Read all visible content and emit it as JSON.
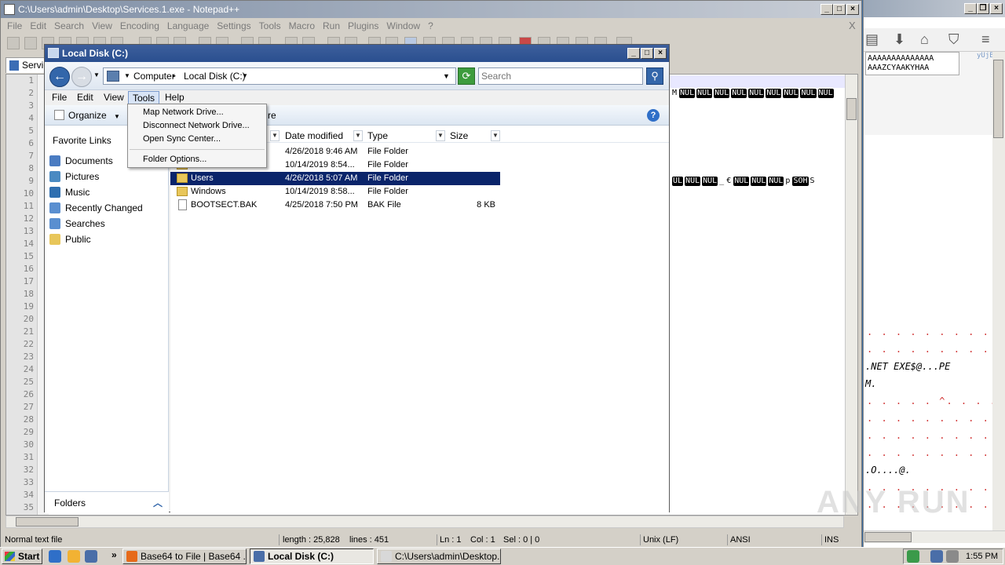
{
  "notepad": {
    "title": "C:\\Users\\admin\\Desktop\\Services.1.exe - Notepad++",
    "menu": [
      "File",
      "Edit",
      "Search",
      "View",
      "Encoding",
      "Language",
      "Settings",
      "Tools",
      "Macro",
      "Run",
      "Plugins",
      "Window",
      "?"
    ],
    "close_x": "X",
    "tab_label": "Servic",
    "line_numbers": [
      "1",
      "2",
      "3",
      "4",
      "5",
      "6",
      "7",
      "8",
      "9",
      "10",
      "11",
      "12",
      "13",
      "14",
      "15",
      "16",
      "17",
      "18",
      "19",
      "20",
      "21",
      "22",
      "23",
      "24",
      "25",
      "26",
      "27",
      "28",
      "29",
      "30",
      "31",
      "32",
      "33",
      "34",
      "35"
    ],
    "line2_tokens": [
      "M",
      "NUL",
      "NUL",
      "NUL",
      "NUL",
      "NUL",
      "NUL",
      "NUL",
      "NUL",
      "NUL"
    ],
    "line9_tokens": [
      "UL",
      "NUL",
      "NUL",
      "_",
      "€",
      "NUL",
      "NUL",
      "NUL",
      "p",
      "SOH",
      "S"
    ],
    "status": {
      "file_type": "Normal text file",
      "length": "length : 25,828",
      "lines": "lines : 451",
      "ln": "Ln : 1",
      "col": "Col : 1",
      "sel": "Sel : 0 | 0",
      "eol": "Unix (LF)",
      "encoding": "ANSI",
      "mode": "INS"
    }
  },
  "browser_strip": {
    "textbox_line1": "AAAAAAAAAAAAAA",
    "textbox_line2": "AAAZCYAAKYHAA",
    "hex_rows": [
      {
        "kind": "dots",
        "text": ". . . . . . . . . . . . . . ."
      },
      {
        "kind": "dots",
        "text": ". . . . . . . . . . . . . ! . ."
      },
      {
        "kind": "hex",
        "text": ".NET EXE$@...PE"
      },
      {
        "kind": "hex",
        "text": "M."
      },
      {
        "kind": "dots",
        "text": ". . . . . ^. . . . . . . . @"
      },
      {
        "kind": "dots",
        "text": ". . . . . . . . . . . . . . . ."
      },
      {
        "kind": "dots",
        "text": ". . . . . . . . . . . . . @."
      },
      {
        "kind": "dots",
        "text": ". . . . . . . . . . . . . . . ."
      },
      {
        "kind": "hex",
        "text": ".O....@."
      },
      {
        "kind": "dots",
        "text": ". . . . . . . . . . . . . . . ."
      },
      {
        "kind": "dots",
        "text": ". . . . . . . . . . . . . . . ."
      }
    ],
    "watermark": "ANY RUN"
  },
  "explorer": {
    "title": "Local Disk (C:)",
    "breadcrumb": [
      "Computer",
      "Local Disk (C:)"
    ],
    "search_placeholder": "Search",
    "menu": [
      "File",
      "Edit",
      "View",
      "Tools",
      "Help"
    ],
    "organize_label": "Organize",
    "partial_cmd_label": "re",
    "favorites_header": "Favorite Links",
    "favorites": [
      {
        "label": "Documents",
        "icon": "documents-icon",
        "color": "#4a7cc2"
      },
      {
        "label": "Pictures",
        "icon": "pictures-icon",
        "color": "#4a8ac2"
      },
      {
        "label": "Music",
        "icon": "music-icon",
        "color": "#2f6fb0"
      },
      {
        "label": "Recently Changed",
        "icon": "recent-icon",
        "color": "#5a8fd0"
      },
      {
        "label": "Searches",
        "icon": "searches-icon",
        "color": "#5a8fd0"
      },
      {
        "label": "Public",
        "icon": "public-folder-icon",
        "color": "#e8c65a"
      }
    ],
    "folders_label": "Folders",
    "columns": {
      "date": "Date modified",
      "type": "Type",
      "size": "Size"
    },
    "rows": [
      {
        "name": "",
        "date": "4/26/2018 9:46 AM",
        "type": "File Folder",
        "size": "",
        "selected": false,
        "file": false
      },
      {
        "name": "",
        "date": "10/14/2019 8:54...",
        "type": "File Folder",
        "size": "",
        "selected": false,
        "file": false
      },
      {
        "name": "Users",
        "date": "4/26/2018 5:07 AM",
        "type": "File Folder",
        "size": "",
        "selected": true,
        "file": false
      },
      {
        "name": "Windows",
        "date": "10/14/2019 8:58...",
        "type": "File Folder",
        "size": "",
        "selected": false,
        "file": false
      },
      {
        "name": "BOOTSECT.BAK",
        "date": "4/25/2018 7:50 PM",
        "type": "BAK File",
        "size": "8 KB",
        "selected": false,
        "file": true
      }
    ],
    "tools_menu": [
      "Map Network Drive...",
      "Disconnect Network Drive...",
      "Open Sync Center...",
      "Folder Options..."
    ]
  },
  "taskbar": {
    "start": "Start",
    "tasks": [
      {
        "label": "Base64 to File | Base64 ...",
        "icon": "firefox-icon",
        "active": false
      },
      {
        "label": "Local Disk (C:)",
        "icon": "explorer-icon",
        "active": true
      },
      {
        "label": "C:\\Users\\admin\\Desktop...",
        "icon": "notepad-icon",
        "active": false
      }
    ],
    "overflow_chevron": "»",
    "clock": "1:55 PM"
  },
  "colors": {
    "selection": "#0a246a",
    "explorer_title": "#2a4f8f",
    "dots": "#d03030"
  }
}
